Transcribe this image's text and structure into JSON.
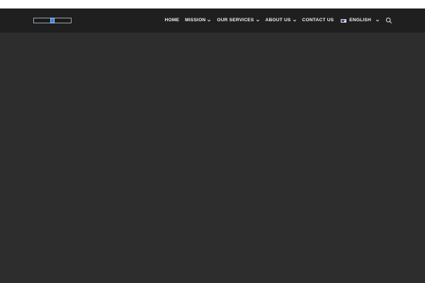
{
  "header": {
    "nav": {
      "home_label": "HOME",
      "mission_label": "MISSION",
      "services_label": "OUR SERVICES",
      "about_label": "ABOUT US",
      "contact_label": "CONTACT US",
      "language_label": "ENGLISH"
    }
  },
  "colors": {
    "header_bg": "#1f1f1f",
    "page_bg": "#2d2d2d",
    "nav_text": "#f2f2f2",
    "logo_accent": "#3f7fd0"
  },
  "icons": {
    "dropdown": "chevron-down-icon",
    "search": "search-icon",
    "language_flag": "us-flag-icon"
  }
}
